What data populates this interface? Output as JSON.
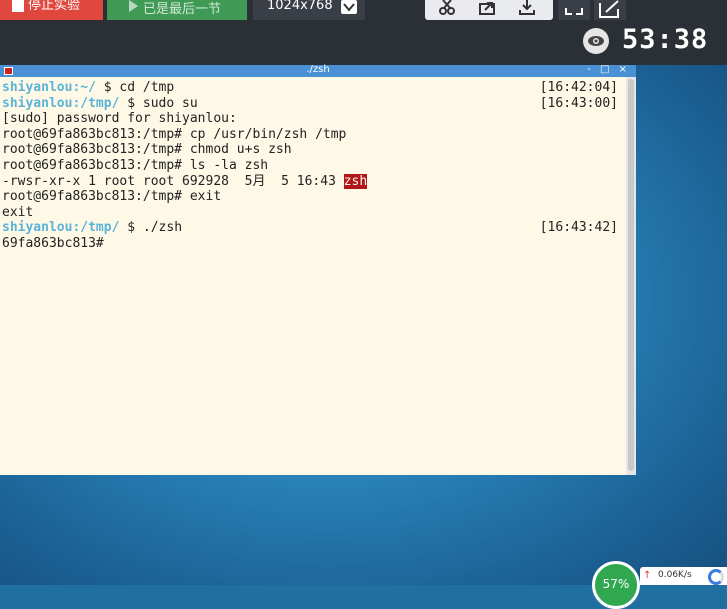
{
  "toolbar": {
    "stop_label": "停止实验",
    "next_label": "已是最后一节",
    "resolution": "1024x768",
    "timer": "53:38"
  },
  "terminal": {
    "title": "./zsh",
    "window_buttons": "- □ ×",
    "lines": [
      {
        "user": "shiyanlou",
        "path": ":~/",
        "cmd": " $ cd /tmp",
        "time": "[16:42:04]"
      },
      {
        "user": "shiyanlou",
        "path": ":/tmp/",
        "cmd": " $ sudo su",
        "time": "[16:43:00]"
      },
      {
        "text": "[sudo] password for shiyanlou:"
      },
      {
        "text": "root@69fa863bc813:/tmp# cp /usr/bin/zsh /tmp"
      },
      {
        "text": "root@69fa863bc813:/tmp# chmod u+s zsh"
      },
      {
        "text": "root@69fa863bc813:/tmp# ls -la zsh"
      },
      {
        "text": "-rwsr-xr-x 1 root root 692928  5月  5 16:43 ",
        "highlight": "zsh"
      },
      {
        "text": "root@69fa863bc813:/tmp# exit"
      },
      {
        "text": "exit"
      },
      {
        "user": "shiyanlou",
        "path": ":/tmp/",
        "cmd": " $ ./zsh",
        "time": "[16:43:42]"
      },
      {
        "text": "69fa863bc813#"
      }
    ]
  },
  "widgets": {
    "cpu": "57%",
    "net_rate": "0.06K/s"
  },
  "colors": {
    "stop_button": "#e0473f",
    "next_button": "#3f9a55",
    "terminal_bg": "#fef8e6",
    "prompt_user": "#5cb3d8",
    "highlight": "#b0161a"
  }
}
